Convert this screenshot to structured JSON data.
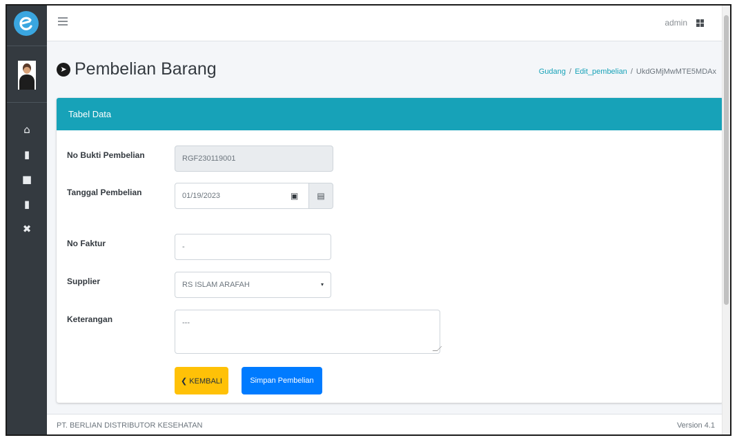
{
  "sidebar": {
    "logo_icon": "brand-e-icon",
    "items": [
      {
        "icon": "home-icon",
        "glyph": "⌂"
      },
      {
        "icon": "book-icon",
        "glyph": "▮"
      },
      {
        "icon": "folder-icon",
        "glyph": "■"
      },
      {
        "icon": "calculator-icon",
        "glyph": "▮"
      },
      {
        "icon": "tools-icon",
        "glyph": "✖"
      }
    ]
  },
  "navbar": {
    "menu_icon": "hamburger-icon",
    "user": "admin",
    "apps_icon": "grid-icon"
  },
  "header": {
    "title": "Pembelian Barang",
    "title_icon": "arrow-circle-right-icon",
    "breadcrumb": {
      "item1": "Gudang",
      "sep": "/",
      "item2": "Edit_pembelian",
      "item3": "UkdGMjMwMTE5MDAx"
    }
  },
  "card": {
    "title": "Tabel Data",
    "header_color": "#17a2b8",
    "fields": {
      "no_bukti": {
        "label": "No Bukti Pembelian",
        "value": "RGF230119001"
      },
      "tanggal": {
        "label": "Tanggal Pembelian",
        "value": "01/19/2023",
        "icon": "calendar-icon"
      },
      "no_faktur": {
        "label": "No Faktur",
        "value": "-"
      },
      "supplier": {
        "label": "Supplier",
        "value": "RS ISLAM ARAFAH",
        "caret": "▾"
      },
      "keterangan": {
        "label": "Keterangan",
        "value": "---"
      }
    },
    "buttons": {
      "back": "❮ KEMBALI",
      "save": "Simpan Pembelian"
    }
  },
  "footer": {
    "company": "PT. BERLIAN DISTRIBUTOR KESEHATAN",
    "version": "Version 4.1"
  }
}
